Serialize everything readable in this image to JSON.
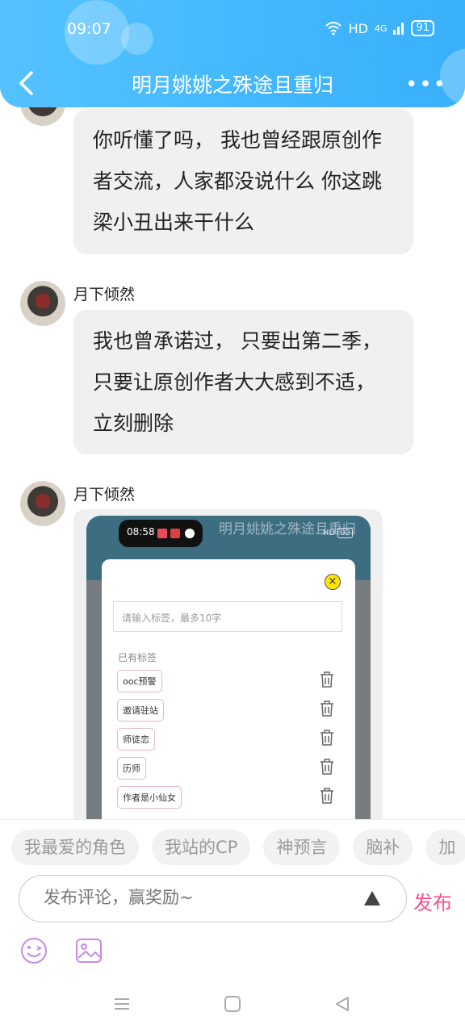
{
  "status_bar": {
    "time": "09:07",
    "network": "HD",
    "signal": "4G",
    "battery": "91"
  },
  "header": {
    "title": "明月姚姚之殊途且重归"
  },
  "messages": [
    {
      "text": "你听懂了吗， 我也曾经跟原创作者交流，人家都没说什么 你这跳梁小丑出来干什么"
    },
    {
      "sender": "月下倾然",
      "text": "我也曾承诺过， 只要出第二季，只要让原创作者大大感到不适，立刻删除"
    },
    {
      "sender": "月下倾然"
    }
  ],
  "shared_image": {
    "time": "08:58",
    "title": "明月姚姚之殊途且重归",
    "status": "HD",
    "battery": "92",
    "input_placeholder": "请输入标签，最多10字",
    "existing_label": "已有标签",
    "tags": [
      "ooc预警",
      "邀请驻站",
      "师徒恋",
      "历师",
      "作者是小仙女"
    ]
  },
  "chips": [
    "我最爱的角色",
    "我站的CP",
    "神预言",
    "脑补",
    "加"
  ],
  "comment": {
    "placeholder": "发布评论，赢奖励~",
    "publish": "发布"
  }
}
